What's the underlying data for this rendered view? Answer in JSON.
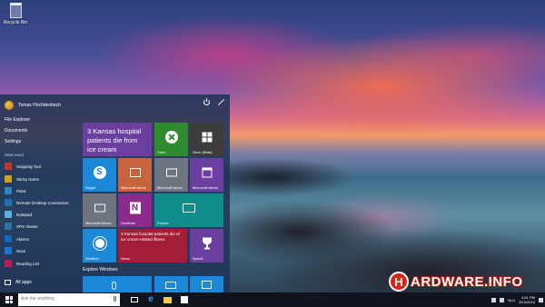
{
  "desktop": {
    "recycle_bin_label": "Recycle Bin"
  },
  "start_menu": {
    "user_name": "Tomas Hochdenbach",
    "places": [
      {
        "label": "File Explorer",
        "icon": "folder-icon"
      },
      {
        "label": "Documents",
        "icon": "documents-icon"
      },
      {
        "label": "Settings",
        "icon": "gear-icon"
      }
    ],
    "most_used_label": "Most used",
    "apps": [
      {
        "label": "Snipping Tool",
        "color": "#c0392b"
      },
      {
        "label": "Sticky Notes",
        "color": "#d4a017"
      },
      {
        "label": "Paint",
        "color": "#2e86c1"
      },
      {
        "label": "Remote Desktop Connection",
        "color": "#1f6fb2"
      },
      {
        "label": "Notepad",
        "color": "#5dade2"
      },
      {
        "label": "XPS Viewer",
        "color": "#2874a6"
      },
      {
        "label": "Alarms",
        "color": "#1565c0"
      },
      {
        "label": "Scan",
        "color": "#1976d2"
      },
      {
        "label": "Reading List",
        "color": "#c2185b"
      }
    ],
    "all_apps_label": "All apps",
    "tiles": {
      "news_headline": "3 Kansas hospital patients die from ice cream contamination",
      "xbox": "Xbox",
      "store": "Store (Beta)",
      "skype": "Skype",
      "people": "Microsoft.windo",
      "mail": "Microsoft.windo",
      "calendar": "Microsoft.windo",
      "photos_app": "Microsoft.Windo",
      "onenote": "OneNote",
      "photos": "Photos",
      "weather": "Weather",
      "news_small": "3 Kansas hospital patients die of ice cream-related illness",
      "news_label": "News",
      "sports": "Sports"
    },
    "explore_label": "Explore Windows"
  },
  "taskbar": {
    "search_placeholder": "Ask me anything",
    "tray_lang": "NLD",
    "time": "3:41 PM",
    "date": "3/14/2015"
  },
  "watermark": {
    "logo_letter": "H",
    "text": "ARDWARE.INFO"
  },
  "colors": {
    "tile_purple": "#6b3fa0",
    "tile_green": "#2e8b2e",
    "tile_dark": "#3c3c3c",
    "tile_blue": "#1e88d8",
    "tile_orange": "#c8643c",
    "tile_gray": "#6d7680",
    "tile_teal": "#108c8c",
    "tile_onenote": "#8e2a8e",
    "tile_news": "#a31d36"
  }
}
